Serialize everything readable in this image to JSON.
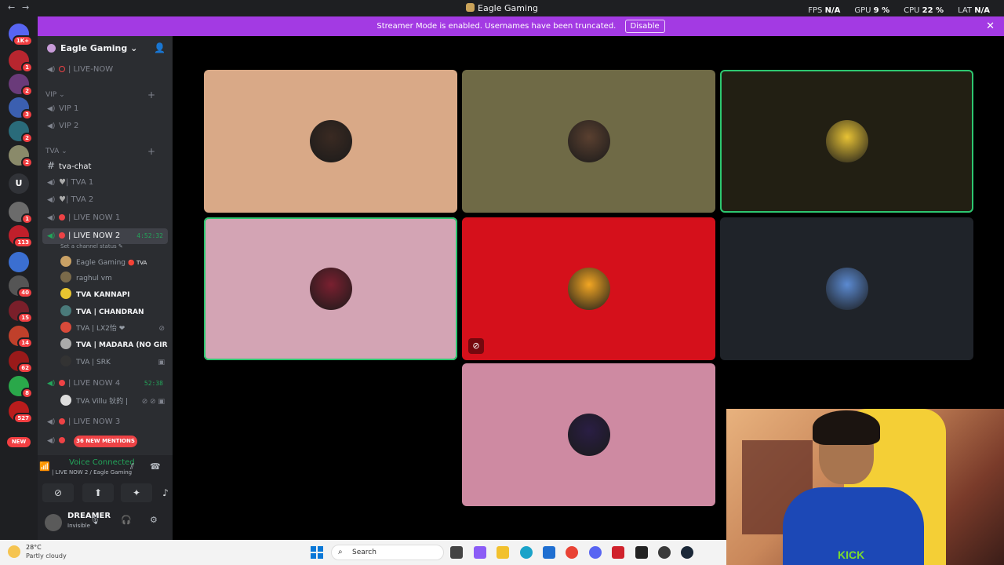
{
  "window": {
    "title": "Eagle Gaming",
    "back": "←",
    "forward": "→"
  },
  "stats": {
    "fps_label": "FPS",
    "fps_value": "N/A",
    "gpu_label": "GPU",
    "gpu_value": "9 %",
    "cpu_label": "CPU",
    "cpu_value": "22 %",
    "lat_label": "LAT",
    "lat_value": "N/A"
  },
  "banner": {
    "text": "Streamer Mode is enabled. Usernames have been truncated.",
    "disable_label": "Disable",
    "close": "✕"
  },
  "servers": [
    {
      "label": "",
      "badge": "1K+",
      "color": "#5865f2"
    },
    {
      "label": "",
      "badge": "1",
      "color": "#b8262f"
    },
    {
      "label": "",
      "badge": "2",
      "color": "#6a3b7a"
    },
    {
      "label": "",
      "badge": "3",
      "color": "#3b5fb0"
    },
    {
      "label": "",
      "badge": "2",
      "color": "#2a6b7a"
    },
    {
      "label": "",
      "badge": "2",
      "color": "#8a8a6a"
    },
    {
      "label": "U",
      "badge": "",
      "color": "#313338"
    },
    {
      "label": "",
      "badge": "1",
      "color": "#6b6b6b"
    },
    {
      "label": "",
      "badge": "113",
      "color": "#c01f2b"
    },
    {
      "label": "",
      "badge": "",
      "color": "#3b6fd1"
    },
    {
      "label": "",
      "badge": "40",
      "color": "#555"
    },
    {
      "label": "",
      "badge": "15",
      "color": "#7a1f2a"
    },
    {
      "label": "",
      "badge": "14",
      "color": "#c0402b"
    },
    {
      "label": "",
      "badge": "62",
      "color": "#9a1a1a"
    },
    {
      "label": "",
      "badge": "8",
      "color": "#2aa84a"
    },
    {
      "label": "",
      "badge": "527",
      "color": "#b91c1c"
    },
    {
      "label": "",
      "badge": "",
      "color": "#444"
    }
  ],
  "server_new": "NEW",
  "sidebar": {
    "guild_name": "Eagle Gaming ⌄",
    "channels_top": [
      {
        "name": "| LIVE-NOW"
      }
    ],
    "cat_vip": "VIP ⌄",
    "vip": [
      "VIP 1",
      "VIP 2"
    ],
    "cat_tva": "TVA ⌄",
    "text_channel": "tva-chat",
    "tva_channels": [
      "| TVA 1",
      "| TVA 2",
      "| LIVE NOW 1"
    ],
    "active_channel": "| LIVE NOW 2",
    "active_timer": "4:52:32",
    "channel_status": "Set a channel status ✎",
    "members": [
      {
        "name": "Eagle Gaming",
        "tag": "🔴 TVA",
        "bold": false,
        "color": "#c9a165",
        "end": ""
      },
      {
        "name": "raghul vm",
        "tag": "",
        "bold": false,
        "color": "#7a6a4a",
        "end": ""
      },
      {
        "name": "TVA KANNAPI",
        "tag": "",
        "bold": true,
        "color": "#e8c530",
        "end": ""
      },
      {
        "name": "TVA | CHANDRAN",
        "tag": "",
        "bold": true,
        "color": "#4a7a7a",
        "end": ""
      },
      {
        "name": "TVA | LX2怡 ❤",
        "tag": "",
        "bold": false,
        "color": "#d94a3a",
        "end": "⊘"
      },
      {
        "name": "TVA | MADARA (NO GIR...",
        "tag": "",
        "bold": true,
        "color": "#aaa",
        "end": ""
      },
      {
        "name": "TVA | SRK",
        "tag": "",
        "bold": false,
        "color": "#333",
        "end": "▣"
      }
    ],
    "live4": "| LIVE NOW 4",
    "live4_timer": "52:38",
    "live4_member": {
      "name": "TVA Villu 钬的 |",
      "end": "⊘ ⊘ ▣"
    },
    "live3": "| LIVE NOW 3",
    "mentions": "36 NEW MENTIONS"
  },
  "voice": {
    "status": "Voice Connected",
    "location": "| LIVE NOW 2 / Eagle Gaming"
  },
  "me": {
    "name": "DREAMER",
    "status": "Invisible"
  },
  "tiles": [
    {
      "color": "#d9a987",
      "avatar": "#3a2a22",
      "speaking": false,
      "muted": false
    },
    {
      "color": "#6f6a46",
      "avatar": "#5a4030",
      "speaking": false,
      "muted": false
    },
    {
      "color": "#221f13",
      "avatar": "#e7c235",
      "speaking": true,
      "muted": false
    },
    {
      "color": "#d3a4b4",
      "avatar": "#7a2030",
      "speaking": true,
      "muted": false
    },
    {
      "color": "#d5101b",
      "avatar": "#f2a623",
      "speaking": false,
      "muted": true
    },
    {
      "color": "#1f2329",
      "avatar": "#5b8ad1",
      "speaking": false,
      "muted": false
    },
    {
      "color": "#ce8aa2",
      "avatar": "#2a1e44",
      "speaking": false,
      "muted": false
    }
  ],
  "webcam": {
    "shirt_text": "KICK"
  },
  "taskbar": {
    "temp": "28°C",
    "weather": "Partly cloudy",
    "search_label": "Search",
    "apps": [
      {
        "name": "task-view",
        "color": "#444"
      },
      {
        "name": "copilot",
        "color": "#8b5cf6"
      },
      {
        "name": "file-explorer",
        "color": "#f2c12e"
      },
      {
        "name": "edge",
        "color": "#1aa3c9"
      },
      {
        "name": "store",
        "color": "#1f6fd1"
      },
      {
        "name": "chrome",
        "color": "#e94335"
      },
      {
        "name": "discord",
        "color": "#5865f2"
      },
      {
        "name": "acrobat",
        "color": "#d0222c"
      },
      {
        "name": "capcut",
        "color": "#222"
      },
      {
        "name": "obs",
        "color": "#3a3a3a"
      },
      {
        "name": "steam",
        "color": "#1b2838"
      }
    ]
  }
}
